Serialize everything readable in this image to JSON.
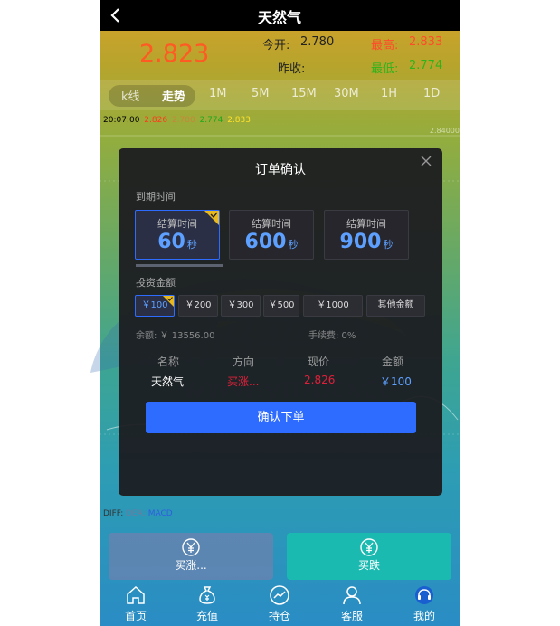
{
  "header": {
    "title": "天然气"
  },
  "quote": {
    "price": "2.823",
    "open_label": "今开:",
    "open_value": "2.780",
    "high_label": "最高:",
    "high_value": "2.833",
    "prev_close_label": "昨收:",
    "low_label": "最低:",
    "low_value": "2.774"
  },
  "tabs": [
    {
      "label": "k线"
    },
    {
      "label": "走势"
    },
    {
      "label": "1M"
    },
    {
      "label": "5M"
    },
    {
      "label": "15M"
    },
    {
      "label": "30M"
    },
    {
      "label": "1H"
    },
    {
      "label": "1D"
    }
  ],
  "info_line": {
    "time": "20:07:00",
    "v1": "2.826",
    "v2": "2.780",
    "v3": "2.774",
    "v4": "2.833"
  },
  "chart_ticks": [
    "2.84000"
  ],
  "indicator": {
    "diff": "DIFF:",
    "dea": "DEA:",
    "macd": "MACD"
  },
  "trade": {
    "up_label": "买涨...",
    "down_label": "买跌"
  },
  "nav": [
    {
      "label": "首页",
      "icon": "home-icon"
    },
    {
      "label": "充值",
      "icon": "money-bag-icon"
    },
    {
      "label": "持仓",
      "icon": "chart-icon"
    },
    {
      "label": "客服",
      "icon": "user-icon"
    },
    {
      "label": "我的",
      "icon": "headset-icon"
    }
  ],
  "modal": {
    "title": "订单确认",
    "expiry_label": "到期时间",
    "time_options": [
      {
        "label": "结算时间",
        "value": "60",
        "unit": "秒"
      },
      {
        "label": "结算时间",
        "value": "600",
        "unit": "秒"
      },
      {
        "label": "结算时间",
        "value": "900",
        "unit": "秒"
      }
    ],
    "amount_label": "投资金额",
    "amounts": [
      "￥100",
      "￥200",
      "￥300",
      "￥500",
      "￥1000",
      "其他金额"
    ],
    "balance": "余额: ￥ 13556.00",
    "fee": "手续费: 0%",
    "table_headers": [
      "名称",
      "方向",
      "现价",
      "金额"
    ],
    "row": {
      "name": "天然气",
      "direction": "买涨...",
      "price": "2.826",
      "amount": "￥100"
    },
    "confirm_label": "确认下单"
  },
  "watermark": {
    "line1": "源码平台",
    "line2": "www.ymptxcc"
  },
  "colors": {
    "accent": "#2e6cff",
    "up": "#e0203a",
    "price": "#ff5a24",
    "high": "#ff4b2b",
    "low": "#2fb31b"
  }
}
